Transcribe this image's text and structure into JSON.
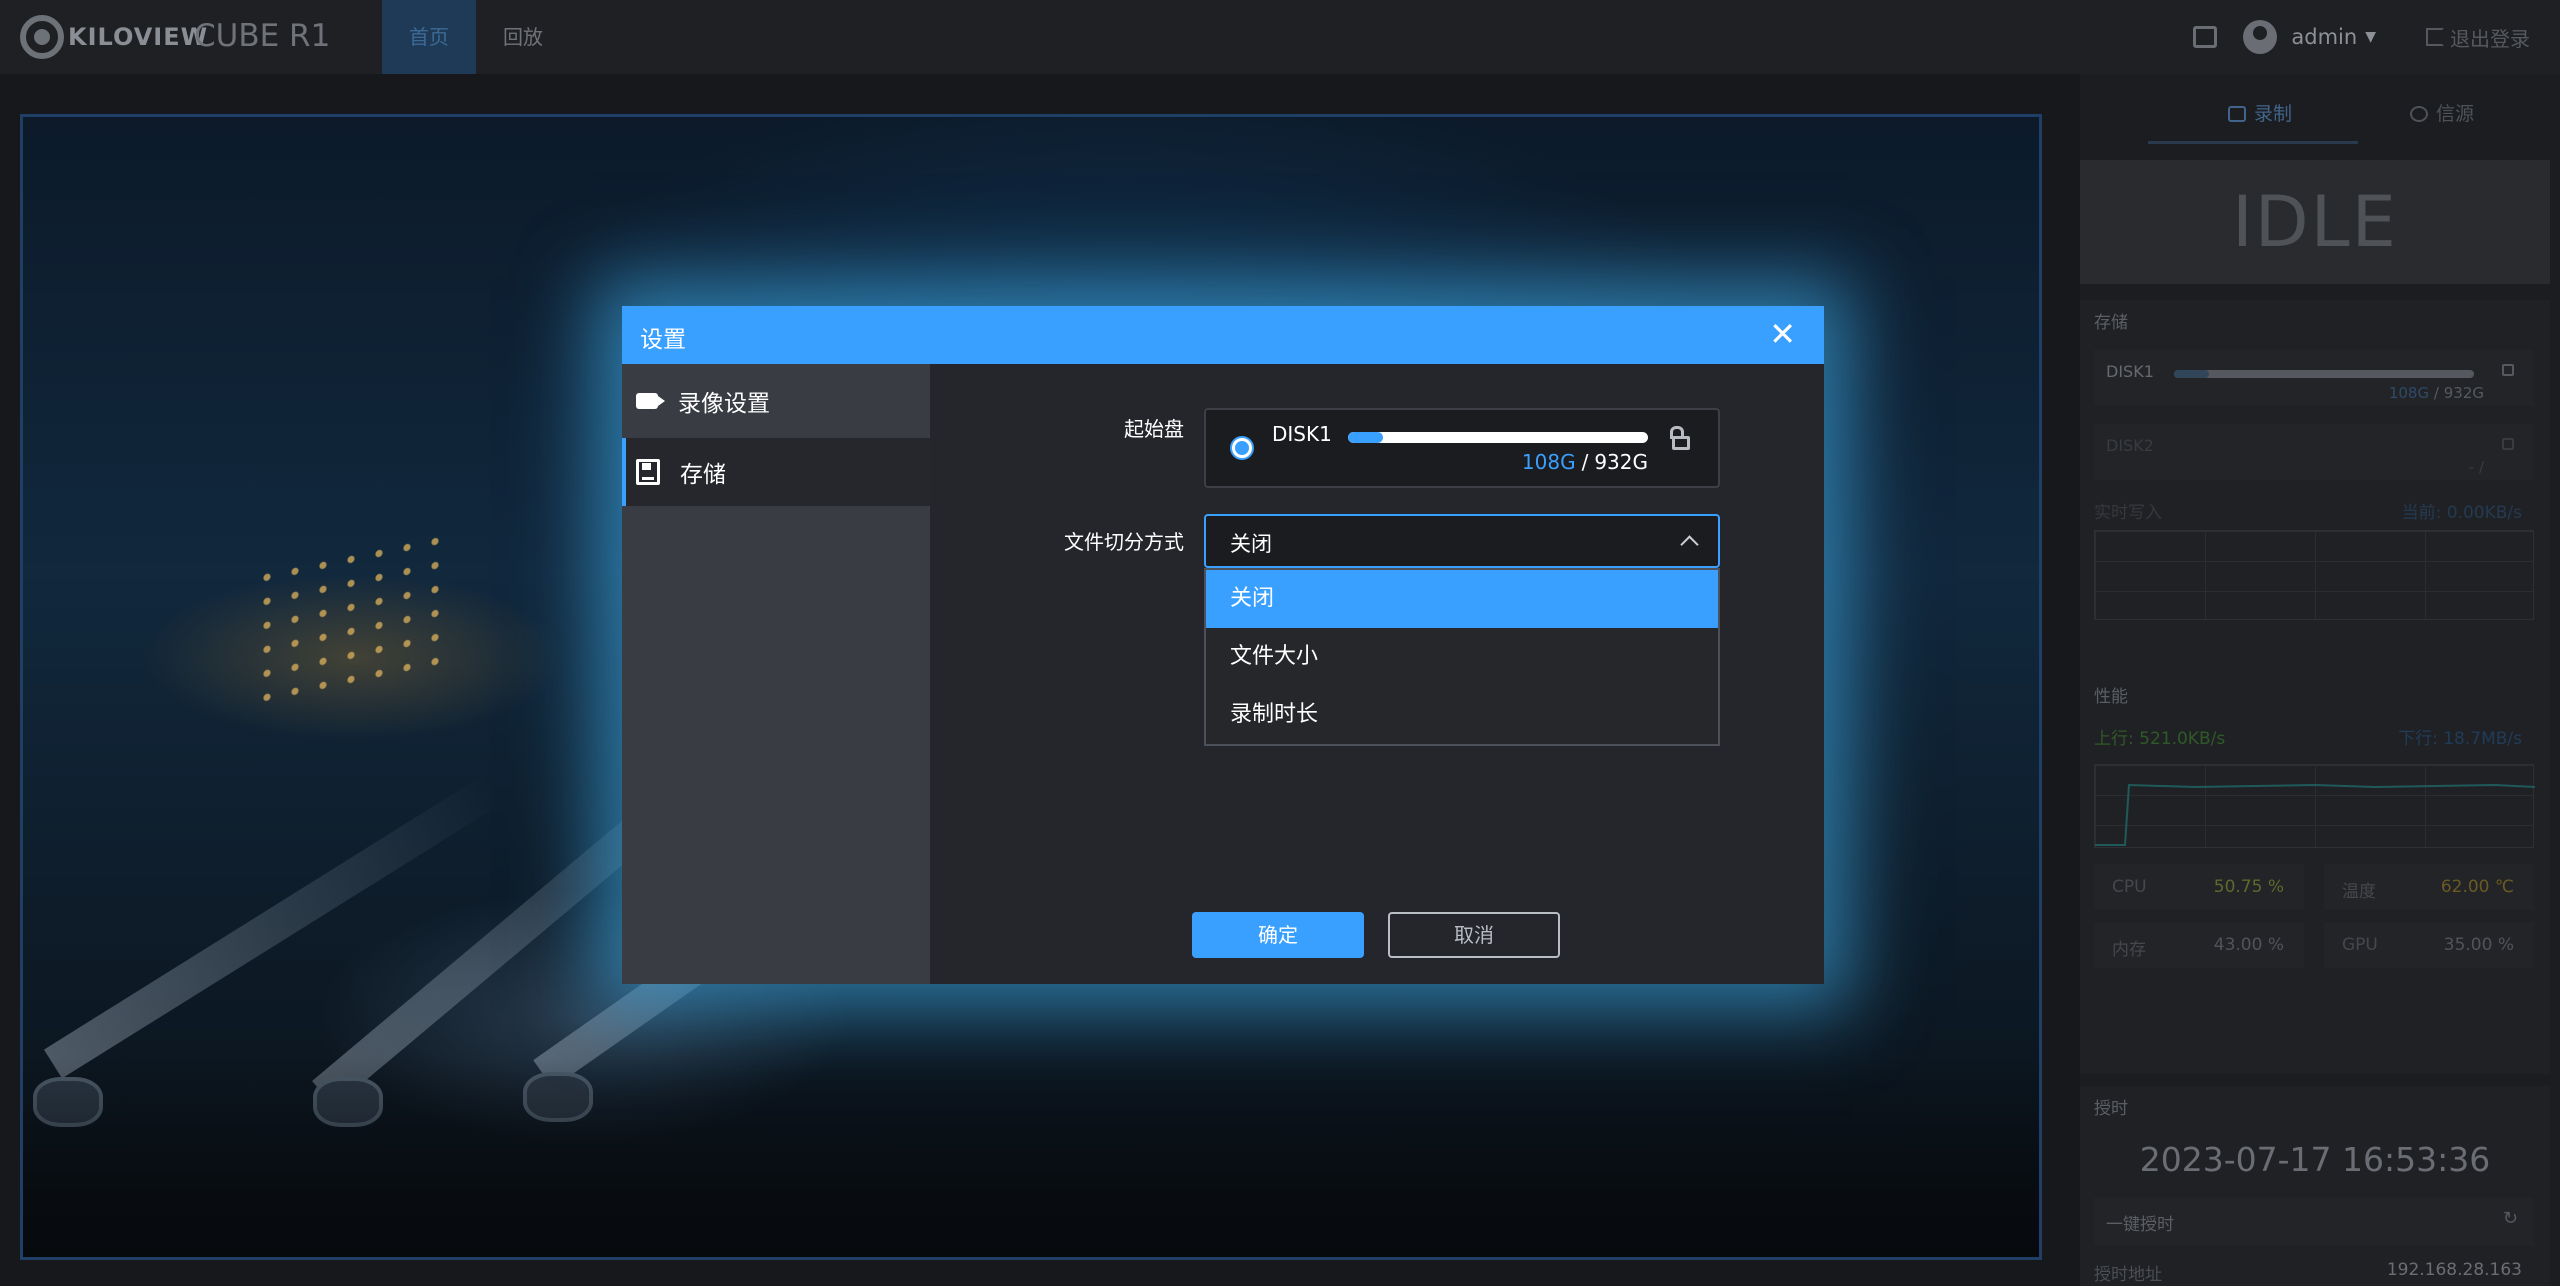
{
  "brand": {
    "logo_text": "KILOVIEW",
    "product": "CUBE R1"
  },
  "nav": [
    {
      "label": "首页",
      "active": true
    },
    {
      "label": "回放",
      "active": false
    }
  ],
  "user": {
    "name": "admin",
    "logout": "退出登录"
  },
  "panel": {
    "tabs": [
      {
        "label": "录制",
        "icon": "record-icon"
      },
      {
        "label": "信源",
        "icon": "signal-icon"
      }
    ],
    "status": "IDLE",
    "storage": {
      "title": "存储",
      "disks": [
        {
          "name": "DISK1",
          "used": "108G",
          "total": "932G",
          "sep": "/",
          "used_fraction": 0.116
        },
        {
          "name": "DISK2",
          "used": "",
          "total": "",
          "sep": "- /",
          "used_fraction": 0
        }
      ],
      "write_label": "实时写入",
      "write_value": "当前: 0.00KB/s"
    },
    "perf": {
      "title": "性能",
      "up": "上行: 521.0KB/s",
      "down": "下行: 18.7MB/s",
      "stats": [
        {
          "key": "CPU",
          "value": "50.75",
          "unit": "%",
          "color": "#5c6a2c"
        },
        {
          "key": "温度",
          "value": "62.00",
          "unit": "℃",
          "color": "#6a5a22"
        },
        {
          "key": "内存",
          "value": "43.00",
          "unit": "%",
          "color": "#50545a"
        },
        {
          "key": "GPU",
          "value": "35.00",
          "unit": "%",
          "color": "#50545a"
        }
      ]
    },
    "timing": {
      "title": "授时",
      "datetime": "2023-07-17 16:53:36",
      "sync_label": "一键授时",
      "addr_label": "授时地址",
      "addr_value": "192.168.28.163"
    }
  },
  "modal": {
    "title": "设置",
    "close": "✕",
    "side": [
      {
        "label": "录像设置",
        "icon": "camera-icon"
      },
      {
        "label": "存储",
        "icon": "floppy-disk-icon",
        "active": true
      }
    ],
    "start_disk_label": "起始盘",
    "disk": {
      "name": "DISK1",
      "used": "108G",
      "sep": "/",
      "total": "932G",
      "used_fraction": 0.116
    },
    "split_label": "文件切分方式",
    "split_value": "关闭",
    "options": [
      "关闭",
      "文件大小",
      "录制时长"
    ],
    "selected_index": 0,
    "ok": "确定",
    "cancel": "取消"
  },
  "colors": {
    "accent": "#3aa0ff",
    "modal_bg": "#24262b",
    "page_bg": "#17181b"
  }
}
